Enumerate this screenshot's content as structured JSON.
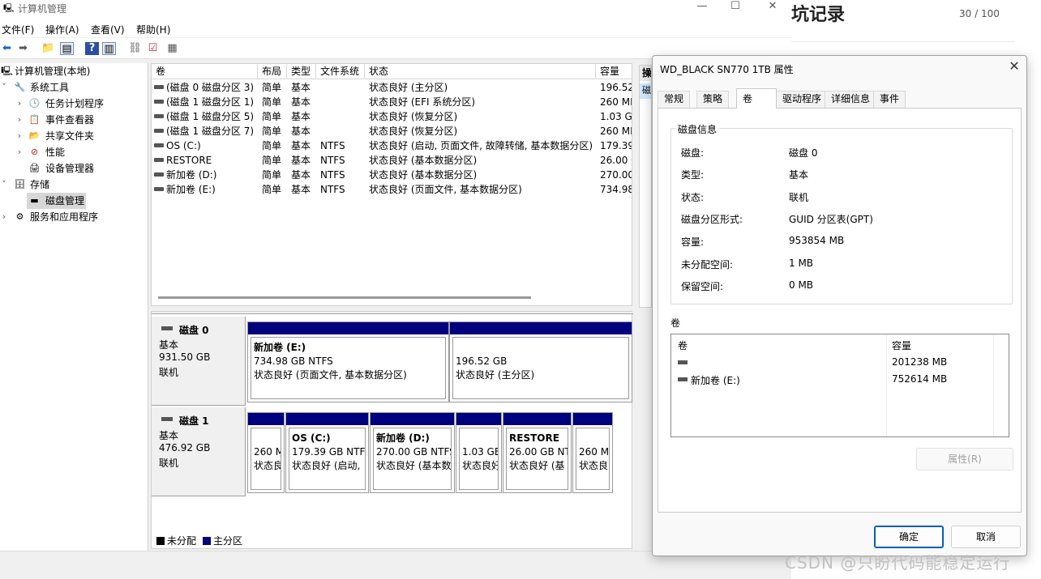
{
  "main_window": {
    "title": "计算机管理",
    "menu": [
      "文件(F)",
      "操作(A)",
      "查看(V)",
      "帮助(H)"
    ],
    "controls": {
      "minimize": "—",
      "maximize": "☐",
      "close": "✕"
    }
  },
  "tree": {
    "root": "计算机管理(本地)",
    "system_tools": "系统工具",
    "task_scheduler": "任务计划程序",
    "event_viewer": "事件查看器",
    "shared_folders": "共享文件夹",
    "performance": "性能",
    "device_manager": "设备管理器",
    "storage": "存储",
    "disk_management": "磁盘管理",
    "services_apps": "服务和应用程序"
  },
  "volume_list": {
    "columns": [
      "卷",
      "布局",
      "类型",
      "文件系统",
      "状态",
      "容量"
    ],
    "rows": [
      {
        "vol": "(磁盘 0 磁盘分区 3)",
        "layout": "简单",
        "type": "基本",
        "fs": "",
        "status": "状态良好 (主分区)",
        "cap": "196.52"
      },
      {
        "vol": "(磁盘 1 磁盘分区 1)",
        "layout": "简单",
        "type": "基本",
        "fs": "",
        "status": "状态良好 (EFI 系统分区)",
        "cap": "260 MB"
      },
      {
        "vol": "(磁盘 1 磁盘分区 5)",
        "layout": "简单",
        "type": "基本",
        "fs": "",
        "status": "状态良好 (恢复分区)",
        "cap": "1.03 GB"
      },
      {
        "vol": "(磁盘 1 磁盘分区 7)",
        "layout": "简单",
        "type": "基本",
        "fs": "",
        "status": "状态良好 (恢复分区)",
        "cap": "260 MB"
      },
      {
        "vol": "OS (C:)",
        "layout": "简单",
        "type": "基本",
        "fs": "NTFS",
        "status": "状态良好 (启动, 页面文件, 故障转储, 基本数据分区)",
        "cap": "179.39"
      },
      {
        "vol": "RESTORE",
        "layout": "简单",
        "type": "基本",
        "fs": "NTFS",
        "status": "状态良好 (基本数据分区)",
        "cap": "26.00 G"
      },
      {
        "vol": "新加卷 (D:)",
        "layout": "简单",
        "type": "基本",
        "fs": "NTFS",
        "status": "状态良好 (基本数据分区)",
        "cap": "270.00"
      },
      {
        "vol": "新加卷 (E:)",
        "layout": "简单",
        "type": "基本",
        "fs": "NTFS",
        "status": "状态良好 (页面文件, 基本数据分区)",
        "cap": "734.98"
      }
    ]
  },
  "action_pane": {
    "header": "操",
    "item": "磁"
  },
  "disks": [
    {
      "name": "磁盘 0",
      "type": "基本",
      "size": "931.50 GB",
      "status": "联机",
      "partitions": [
        {
          "name": "新加卷 (E:)",
          "size": "734.98 GB NTFS",
          "status": "状态良好 (页面文件, 基本数据分区)"
        },
        {
          "name": "",
          "size": "196.52 GB",
          "status": "状态良好 (主分区)"
        }
      ]
    },
    {
      "name": "磁盘 1",
      "type": "基本",
      "size": "476.92 GB",
      "status": "联机",
      "partitions": [
        {
          "name": "",
          "size": "260 M",
          "status": "状态良"
        },
        {
          "name": "OS (C:)",
          "size": "179.39 GB NTF",
          "status": "状态良好 (启动,"
        },
        {
          "name": "新加卷 (D:)",
          "size": "270.00 GB NTFS",
          "status": "状态良好 (基本数"
        },
        {
          "name": "",
          "size": "1.03 GB",
          "status": "状态良好"
        },
        {
          "name": "RESTORE",
          "size": "26.00 GB NT",
          "status": "状态良好 (基"
        },
        {
          "name": "",
          "size": "260 M",
          "status": "状态良"
        }
      ]
    }
  ],
  "legend": {
    "unallocated": "未分配",
    "primary": "主分区"
  },
  "blog": {
    "title": "坑记录",
    "counter": "30 / 100"
  },
  "dialog": {
    "title": "WD_BLACK SN770 1TB 属性",
    "close": "✕",
    "tabs": [
      "常规",
      "策略",
      "卷",
      "驱动程序",
      "详细信息",
      "事件"
    ],
    "active_tab": "卷",
    "disk_info_label": "磁盘信息",
    "info": [
      {
        "k": "磁盘:",
        "v": "磁盘 0"
      },
      {
        "k": "类型:",
        "v": "基本"
      },
      {
        "k": "状态:",
        "v": "联机"
      },
      {
        "k": "磁盘分区形式:",
        "v": "GUID 分区表(GPT)"
      },
      {
        "k": "容量:",
        "v": "953854 MB"
      },
      {
        "k": "未分配空间:",
        "v": "1 MB"
      },
      {
        "k": "保留空间:",
        "v": "0 MB"
      }
    ],
    "volumes_label": "卷",
    "vol_table": {
      "headers": [
        "卷",
        "容量"
      ],
      "rows": [
        {
          "vol": "",
          "cap": "201238 MB"
        },
        {
          "vol": "新加卷 (E:)",
          "cap": "752614 MB"
        }
      ]
    },
    "properties_button": "属性(R)",
    "ok_button": "确定",
    "cancel_button": "取消"
  },
  "watermark": "CSDN @只盼代码能稳定运行",
  "colors": {
    "primary_partition": "#00007f",
    "unallocated": "#000000",
    "accent_button": "#005fb8"
  }
}
